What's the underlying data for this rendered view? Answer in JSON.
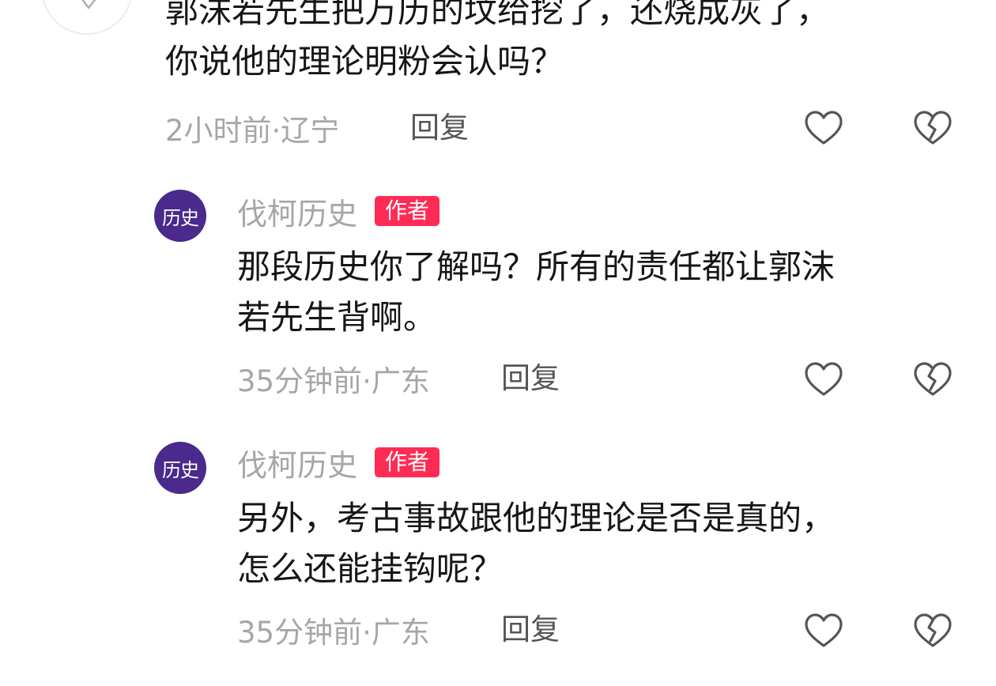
{
  "comments": [
    {
      "text": "郭沫若先生把万历的坟给挖了，还烧成灰了，\n你说他的理论明粉会认吗？",
      "meta": "2小时前·辽宁",
      "reply_label": "回复",
      "like_icon": "heart-outline-icon",
      "dislike_icon": "broken-heart-icon"
    }
  ],
  "replies": [
    {
      "avatar_text": "历史",
      "author": "伐柯历史",
      "badge": "作者",
      "text": "那段历史你了解吗？所有的责任都让郭沫\n若先生背啊。",
      "meta": "35分钟前·广东",
      "reply_label": "回复",
      "like_icon": "heart-outline-icon",
      "dislike_icon": "broken-heart-icon"
    },
    {
      "avatar_text": "历史",
      "author": "伐柯历史",
      "badge": "作者",
      "text": "另外，考古事故跟他的理论是否是真的，\n怎么还能挂钩呢？",
      "meta": "35分钟前·广东",
      "reply_label": "回复",
      "like_icon": "heart-outline-icon",
      "dislike_icon": "broken-heart-icon"
    }
  ],
  "colors": {
    "badge": "#fe2c55",
    "avatar": "#4a2a8c",
    "meta": "#a6a6a6",
    "text": "#161616"
  }
}
